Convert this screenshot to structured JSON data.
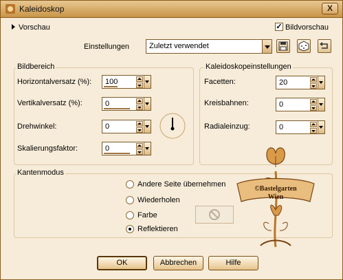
{
  "window": {
    "title": "Kaleidoskop",
    "close_label": "X"
  },
  "preview": {
    "label": "Vorschau",
    "checkbox_label": "Bildvorschau",
    "checked": true
  },
  "settings": {
    "label": "Einstellungen",
    "value": "Zuletzt verwendet"
  },
  "image_area": {
    "title": "Bildbereich",
    "fields": [
      {
        "label": "Horizontalversatz (%):",
        "value": "100"
      },
      {
        "label": "Vertikalversatz (%):",
        "value": "0"
      },
      {
        "label": "Drehwinkel:",
        "value": "0"
      },
      {
        "label": "Skalierungsfaktor:",
        "value": "0"
      }
    ]
  },
  "kaleido": {
    "title": "Kaleidoskopeinstellungen",
    "fields": [
      {
        "label": "Facetten:",
        "value": "20"
      },
      {
        "label": "Kreisbahnen:",
        "value": "0"
      },
      {
        "label": "Radialeinzug:",
        "value": "0"
      }
    ]
  },
  "edge_mode": {
    "title": "Kantenmodus",
    "options": [
      {
        "label": "Andere Seite übernehmen",
        "selected": false
      },
      {
        "label": "Wiederholen",
        "selected": false
      },
      {
        "label": "Farbe",
        "selected": false
      },
      {
        "label": "Reflektieren",
        "selected": true
      }
    ]
  },
  "watermark": {
    "line1": "©Bastelgarten",
    "line2": "Wien"
  },
  "buttons": {
    "ok": "OK",
    "cancel": "Abbrechen",
    "help": "Hilfe"
  },
  "colors": {
    "title_bar": "#d9aa62",
    "background": "#f7ecd9",
    "accent": "#b8742a"
  }
}
